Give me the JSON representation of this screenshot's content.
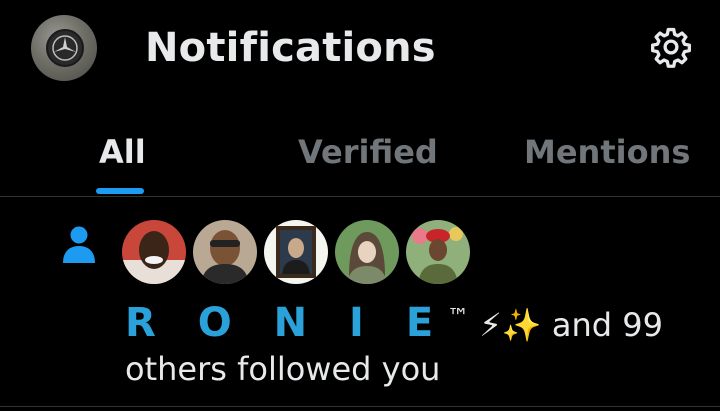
{
  "header": {
    "title": "Notifications",
    "avatar_icon": "user-avatar",
    "settings_icon": "gear-icon"
  },
  "tabs": [
    {
      "label": "All",
      "active": true
    },
    {
      "label": "Verified",
      "active": false
    },
    {
      "label": "Mentions",
      "active": false
    }
  ],
  "notification": {
    "type_icon": "person-icon",
    "name": "R O N I E",
    "tm": "™",
    "emoji": "⚡✨",
    "and_text": "and 99",
    "rest_text": "others followed you",
    "follower_avatars": [
      "follower-avatar-1",
      "follower-avatar-2",
      "follower-avatar-3",
      "follower-avatar-4",
      "follower-avatar-5"
    ]
  },
  "colors": {
    "accent": "#1d9bf0",
    "name_color": "#2aa1d8",
    "muted": "#71767b",
    "text": "#e7e9ea",
    "background": "#000000"
  }
}
